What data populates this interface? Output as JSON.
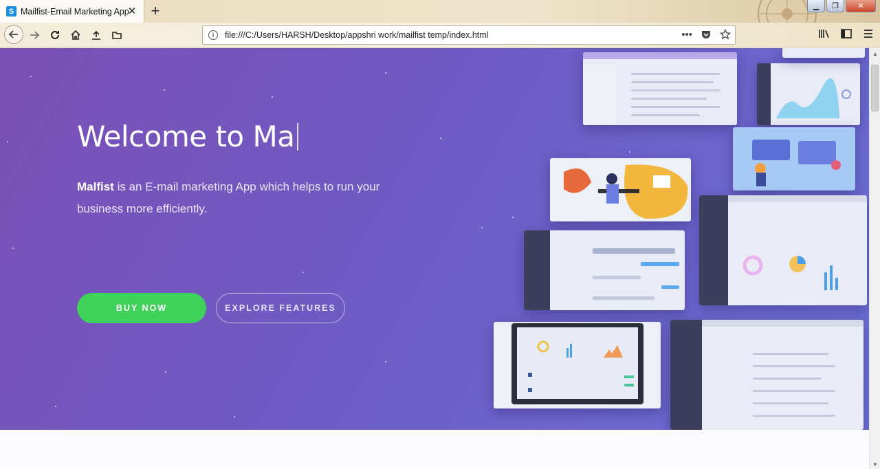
{
  "browser": {
    "tab_title": "Mailfist-Email Marketing App",
    "tab_favicon_letter": "S",
    "tab_close": "✕",
    "new_tab": "+",
    "url": "file:///C:/Users/HARSH/Desktop/appshri work/mailfist temp/index.html",
    "window_buttons": {
      "minimize": "▁",
      "maximize": "❐",
      "close": "✕"
    },
    "nav_icons": [
      "back-arrow-icon",
      "forward-arrow-icon",
      "reload-icon",
      "home-icon",
      "upload-icon",
      "folder-icon"
    ],
    "colors": {
      "chrome": "#efe4cb",
      "tab": "#fbfaf7"
    }
  },
  "hero": {
    "title": "Welcome to  Ma",
    "brand": "Malfist",
    "description": " is an E-mail marketing App which helps to run your business more efficiently.",
    "buy_label": "BUY NOW",
    "explore_label": "EXPLORE FEATURES",
    "colors": {
      "gradient_start": "#7b4fb4",
      "gradient_end": "#6b70d6",
      "buy_button": "#3fd15a"
    }
  }
}
